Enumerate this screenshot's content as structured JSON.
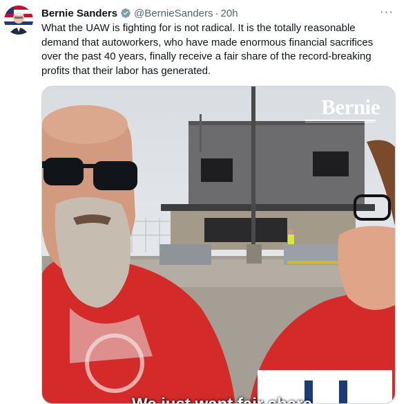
{
  "tweet": {
    "author_name": "Bernie Sanders",
    "handle": "@BernieSanders",
    "separator": "·",
    "time": "20h",
    "more_label": "···",
    "text": "What the UAW is fighting for is not radical. It is the totally reasonable demand that autoworkers, who have made enormous financial sacrifices over the past 40 years, finally receive a fair share of the record-breaking profits that their labor has generated."
  },
  "media": {
    "watermark": "Bernie",
    "caption": "We just want fair share"
  },
  "colors": {
    "text": "#0f1419",
    "muted": "#536471",
    "verified": "#1d9bf0",
    "shirt": "#e02424"
  },
  "icons": [
    "verified-badge-icon",
    "more-options-icon"
  ]
}
